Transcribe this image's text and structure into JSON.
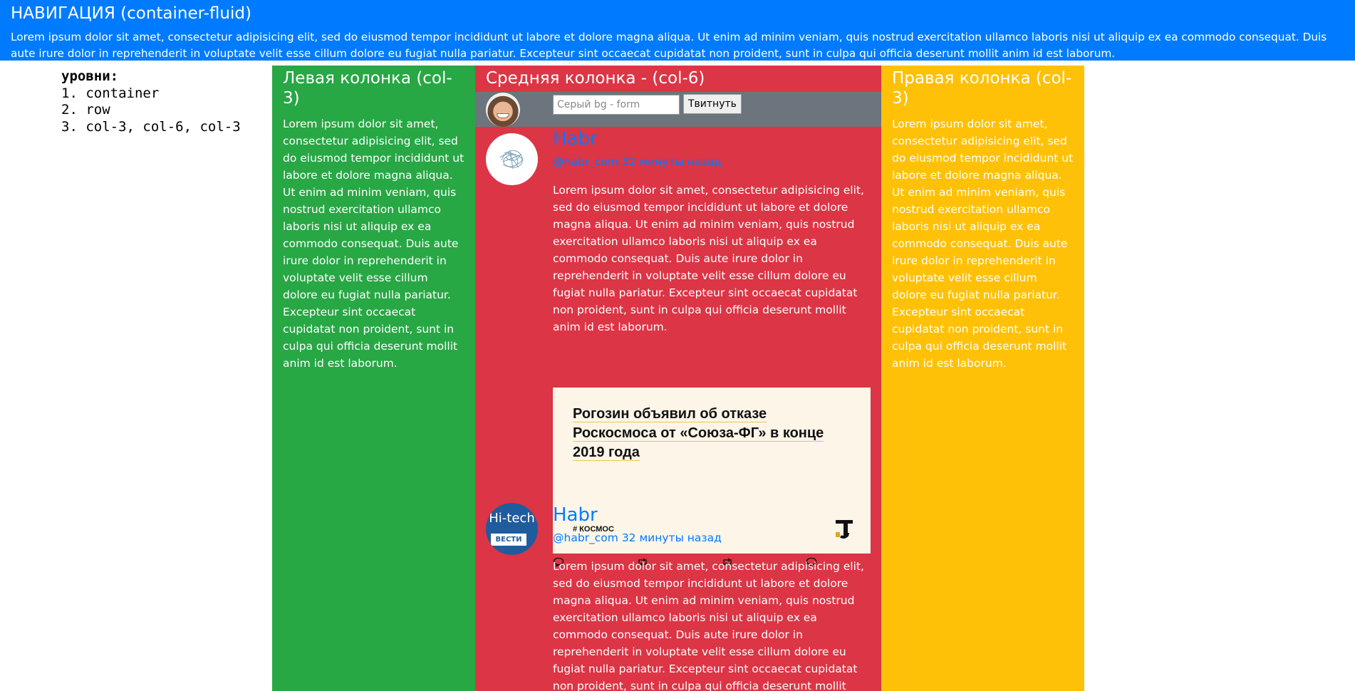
{
  "nav": {
    "title": "НАВИГАЦИЯ (container-fluid)",
    "text": "Lorem ipsum dolor sit amet, consectetur adipisicing elit, sed do eiusmod tempor incididunt ut labore et dolore magna aliqua. Ut enim ad minim veniam, quis nostrud exercitation ullamco laboris nisi ut aliquip ex ea commodo consequat. Duis aute irure dolor in reprehenderit in voluptate velit esse cillum dolore eu fugiat nulla pariatur. Excepteur sint occaecat cupidatat non proident, sunt in culpa qui officia deserunt mollit anim id est laborum."
  },
  "levels": {
    "heading": "уровни:",
    "items": [
      "1. container",
      "2. row",
      "3. col-3, col-6, col-3"
    ]
  },
  "left": {
    "title": "Левая колонка (col-3)",
    "text": "Lorem ipsum dolor sit amet, consectetur adipisicing elit, sed do eiusmod tempor incididunt ut labore et dolore magna aliqua. Ut enim ad minim veniam, quis nostrud exercitation ullamco laboris nisi ut aliquip ex ea commodo consequat. Duis aute irure dolor in reprehenderit in voluptate velit esse cillum dolore eu fugiat nulla pariatur. Excepteur sint occaecat cupidatat non proident, sunt in culpa qui officia deserunt mollit anim id est laborum."
  },
  "middle": {
    "title": "Средняя колонка - (col-6)",
    "form": {
      "placeholder": "Серый bg - form",
      "button": "Твитнуть"
    },
    "tweets": [
      {
        "name": "Habr",
        "meta": "@habr_com 32 минуты назад",
        "text": "Lorem ipsum dolor sit amet, consectetur adipisicing elit, sed do eiusmod tempor incididunt ut labore et dolore magna aliqua. Ut enim ad minim veniam, quis nostrud exercitation ullamco laboris nisi ut aliquip ex ea commodo consequat. Duis aute irure dolor in reprehenderit in voluptate velit esse cillum dolore eu fugiat nulla pariatur. Excepteur sint occaecat cupidatat non proident, sunt in culpa qui officia deserunt mollit anim id est laborum.",
        "card": {
          "title": "Рогозин объявил об отказе Роскосмоса от «Союза-ФГ» в конце 2019 года",
          "tag": "# КОСМОС"
        }
      },
      {
        "name": "Habr",
        "meta": "@habr_com 32 минуты назад",
        "avatar_text": "Hi-tech",
        "avatar_badge": "ВЕСТИ",
        "text": "Lorem ipsum dolor sit amet, consectetur adipisicing elit, sed do eiusmod tempor incididunt ut labore et dolore magna aliqua. Ut enim ad minim veniam, quis nostrud exercitation ullamco laboris nisi ut aliquip ex ea commodo consequat. Duis aute irure dolor in reprehenderit in voluptate velit esse cillum dolore eu fugiat nulla pariatur. Excepteur sint occaecat cupidatat non proident, sunt in culpa qui officia deserunt mollit anim id est laborum."
      }
    ]
  },
  "right": {
    "title": "Правая колонка (col-3)",
    "text": "Lorem ipsum dolor sit amet, consectetur adipisicing elit, sed do eiusmod tempor incididunt ut labore et dolore magna aliqua. Ut enim ad minim veniam, quis nostrud exercitation ullamco laboris nisi ut aliquip ex ea commodo consequat. Duis aute irure dolor in reprehenderit in voluptate velit esse cillum dolore eu fugiat nulla pariatur. Excepteur sint occaecat cupidatat non proident, sunt in culpa qui officia deserunt mollit anim id est laborum."
  },
  "colors": {
    "nav_bg": "#007bff",
    "left_bg": "#28a745",
    "middle_bg": "#dc3545",
    "right_bg": "#ffc107",
    "form_bg": "#6c757d",
    "link": "#007bff"
  },
  "icons": [
    "reply-icon",
    "retweet-icon",
    "retweet-icon",
    "comment-icon"
  ]
}
